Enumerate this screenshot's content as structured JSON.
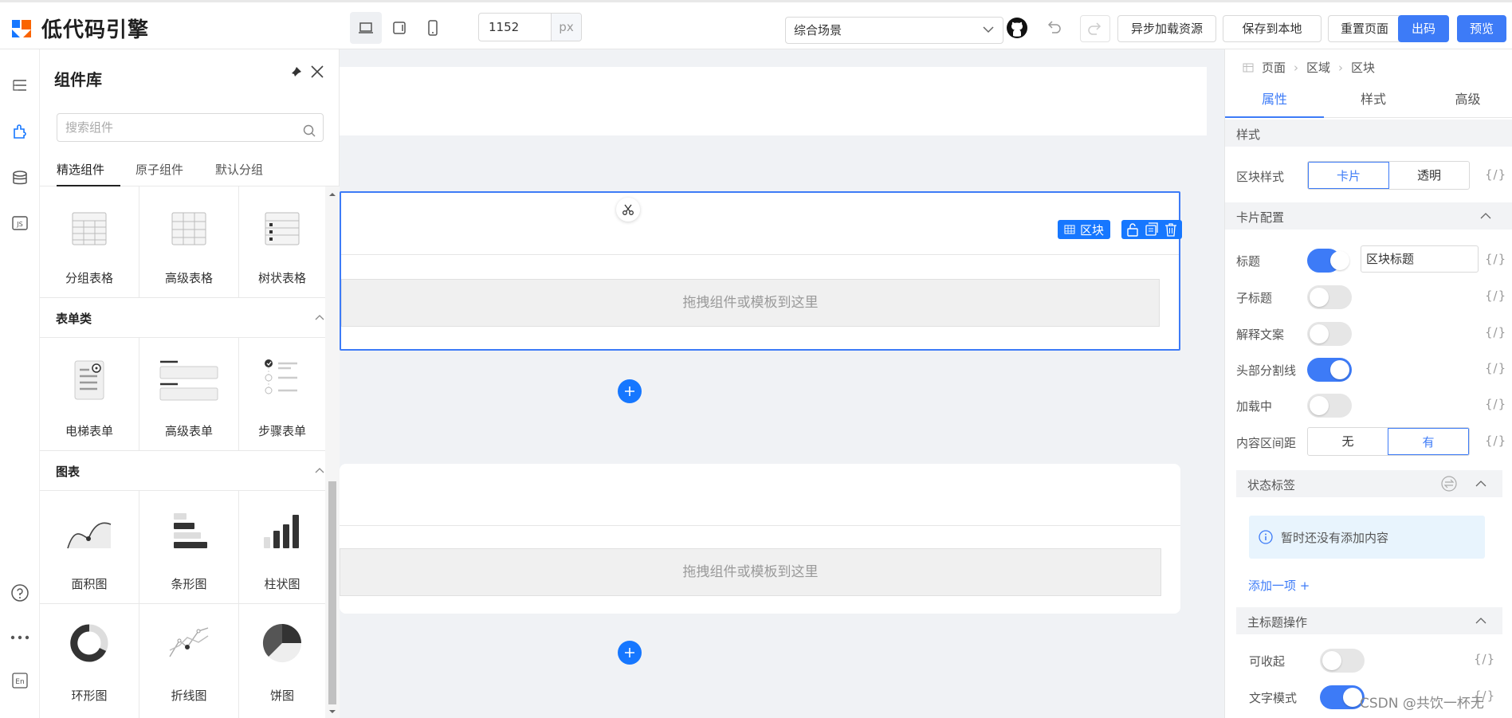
{
  "topbar": {
    "brand": "低代码引擎",
    "width_value": "1152",
    "width_unit": "px",
    "scene": "综合场景",
    "buttons": {
      "async": "异步加载资源",
      "save_local": "保存到本地",
      "reset": "重置页面",
      "export": "出码",
      "preview": "预览"
    },
    "accent": "#3d7bf7"
  },
  "left_icons": [
    "outline-icon",
    "component-icon",
    "datasource-icon",
    "js-icon",
    "help-icon",
    "more-icon",
    "lang-icon"
  ],
  "component_panel": {
    "title": "组件库",
    "search_placeholder": "搜索组件",
    "tabs": [
      "精选组件",
      "原子组件",
      "默认分组"
    ],
    "groups": [
      {
        "title": "",
        "items": [
          "分组表格",
          "高级表格",
          "树状表格"
        ]
      },
      {
        "title": "表单类",
        "items": [
          "电梯表单",
          "高级表单",
          "步骤表单"
        ]
      },
      {
        "title": "图表",
        "items": [
          "面积图",
          "条形图",
          "柱状图",
          "环形图",
          "折线图",
          "饼图"
        ]
      }
    ]
  },
  "canvas": {
    "drop_hint_1": "拖拽组件或模板到这里",
    "drop_hint_2": "拖拽组件或模板到这里",
    "block_tag": "区块"
  },
  "settings": {
    "breadcrumb": [
      "页面",
      "区域",
      "区块"
    ],
    "tabs": [
      "属性",
      "样式",
      "高级"
    ],
    "style_section": "样式",
    "block_style_label": "区块样式",
    "block_style_options": [
      "卡片",
      "透明"
    ],
    "card_config_section": "卡片配置",
    "title_label": "标题",
    "title_value": "区块标题",
    "subtitle_label": "子标题",
    "explain_label": "解释文案",
    "divider_label": "头部分割线",
    "loading_label": "加载中",
    "padding_label": "内容区间距",
    "padding_options": [
      "无",
      "有"
    ],
    "status_tag_section": "状态标签",
    "empty_text": "暂时还没有添加内容",
    "add_item": "添加一项 +",
    "main_title_ops_section": "主标题操作",
    "collapsible_label": "可收起",
    "text_mode_label": "文字模式",
    "expr": "{/}"
  },
  "watermark": "CSDN @共饮一杯无"
}
